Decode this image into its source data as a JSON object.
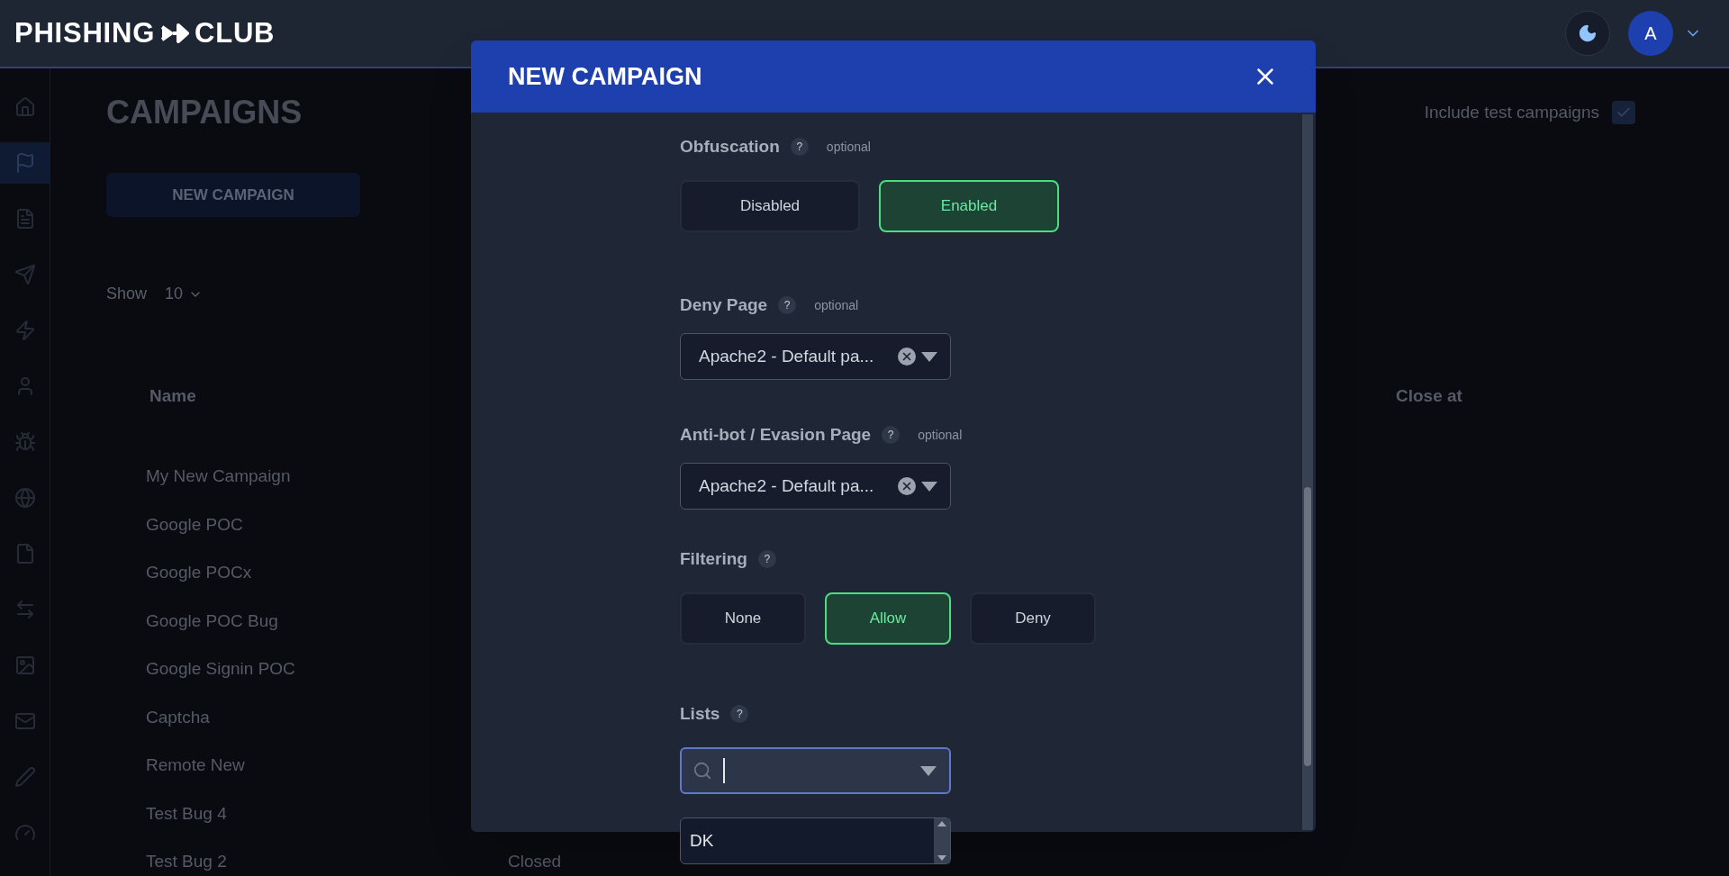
{
  "header": {
    "logo_left": "PHISHING",
    "logo_right": "CLUB",
    "avatar": "A"
  },
  "sidebar": {
    "items": [
      {
        "selected": false
      },
      {
        "selected": true
      },
      {
        "selected": false
      },
      {
        "selected": false
      },
      {
        "selected": false
      },
      {
        "selected": false
      },
      {
        "selected": false
      },
      {
        "selected": false
      },
      {
        "selected": false
      },
      {
        "selected": false
      },
      {
        "selected": false
      },
      {
        "selected": false
      },
      {
        "selected": false
      },
      {
        "selected": false
      }
    ]
  },
  "page": {
    "title": "CAMPAIGNS",
    "new_button": "NEW CAMPAIGN",
    "show_label": "Show",
    "show_value": "10",
    "include_test_label": "Include test campaigns",
    "include_test_checked": true,
    "table": {
      "columns": [
        "Name",
        "Close at"
      ],
      "rows": [
        {
          "name": "My New Campaign"
        },
        {
          "name": "Google POC"
        },
        {
          "name": "Google POCx"
        },
        {
          "name": "Google POC Bug"
        },
        {
          "name": "Google Signin POC"
        },
        {
          "name": "Captcha"
        },
        {
          "name": "Remote New"
        },
        {
          "name": "Test Bug 4"
        },
        {
          "name": "Test Bug 2",
          "status": "Closed"
        }
      ]
    }
  },
  "modal": {
    "title": "NEW CAMPAIGN",
    "fields": [
      {
        "kind": "toggle",
        "label": "Obfuscation",
        "help": "?",
        "optional": "optional",
        "options": [
          {
            "label": "Disabled",
            "selected": false
          },
          {
            "label": "Enabled",
            "selected": true
          }
        ]
      },
      {
        "kind": "select",
        "label": "Deny Page",
        "help": "?",
        "optional": "optional",
        "value": "Apache2 - Default pa..."
      },
      {
        "kind": "select",
        "label": "Anti-bot / Evasion Page",
        "help": "?",
        "optional": "optional",
        "value": "Apache2 - Default pa..."
      },
      {
        "kind": "toggle",
        "label": "Filtering",
        "help": "?",
        "options": [
          {
            "label": "None",
            "selected": false
          },
          {
            "label": "Allow",
            "selected": true
          },
          {
            "label": "Deny",
            "selected": false
          }
        ]
      },
      {
        "kind": "search",
        "label": "Lists",
        "help": "?",
        "options": [
          {
            "label": "DK"
          }
        ]
      }
    ]
  }
}
